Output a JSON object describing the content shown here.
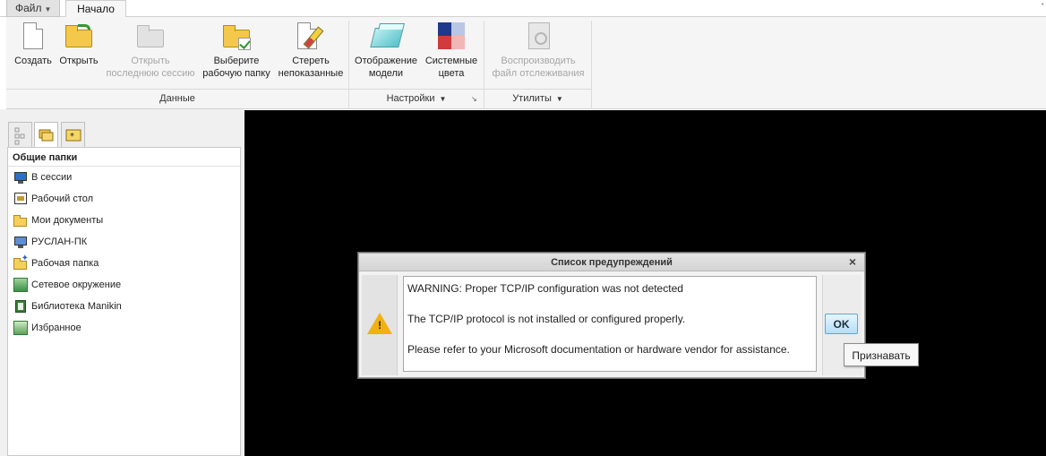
{
  "tabs": {
    "file": "Файл",
    "home": "Начало"
  },
  "ribbon": {
    "create": "Создать",
    "open": "Открыть",
    "open_last_session": [
      "Открыть",
      "последнюю сессию"
    ],
    "select_workdir": [
      "Выберите",
      "рабочую папку"
    ],
    "erase_undisplayed": [
      "Стереть",
      "непоказанные"
    ],
    "model_display": [
      "Отображение",
      "модели"
    ],
    "system_colors": [
      "Системные",
      "цвета"
    ],
    "play_trail": [
      "Воспроизводить",
      "файл отслеживания"
    ],
    "groups": {
      "data": "Данные",
      "settings": "Настройки",
      "utilities": "Утилиты"
    }
  },
  "sidebar": {
    "header": "Общие папки",
    "items": [
      {
        "label": "В сессии",
        "icon": "monitor-icon"
      },
      {
        "label": "Рабочий стол",
        "icon": "desktop-icon"
      },
      {
        "label": "Мои документы",
        "icon": "folder-open-icon"
      },
      {
        "label": "РУСЛАН-ПК",
        "icon": "computer-icon"
      },
      {
        "label": "Рабочая папка",
        "icon": "working-folder-icon"
      },
      {
        "label": "Сетевое окружение",
        "icon": "network-icon"
      },
      {
        "label": "Библиотека Manikin",
        "icon": "library-icon"
      },
      {
        "label": "Избранное",
        "icon": "favorites-icon"
      }
    ]
  },
  "dialog": {
    "title": "Список предупреждений",
    "close": "×",
    "lines": [
      "WARNING: Proper TCP/IP configuration was not detected",
      "The TCP/IP protocol is not installed or configured properly.",
      "Please refer to your Microsoft documentation or hardware vendor for assistance."
    ],
    "ok_label": "OK",
    "tooltip": "Признавать"
  },
  "colors": {
    "canvas": "#000000",
    "ok_button": "#b4def7",
    "warning": "#f2b10e"
  }
}
